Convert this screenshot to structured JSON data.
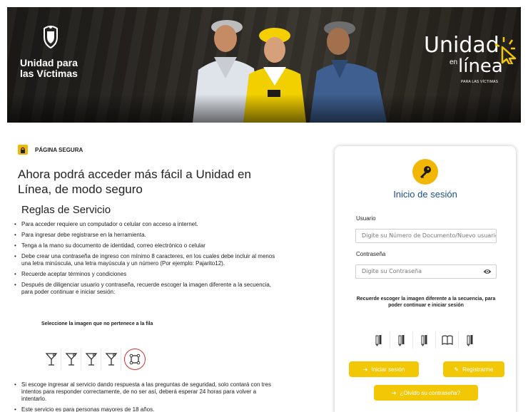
{
  "banner": {
    "org_name_line1": "Unidad para",
    "org_name_line2": "las Víctimas",
    "product_word1": "Unidad",
    "product_en": "en",
    "product_word2": "línea",
    "product_tag": "PARA LAS VÍCTIMAS"
  },
  "secure": {
    "label": "PÁGINA SEGURA",
    "icon": "lock-icon"
  },
  "headline": "Ahora podrá acceder más fácil a Unidad en Línea, de modo seguro",
  "rules_title": "Reglas de Servicio",
  "rules": [
    "Para acceder requiere un computador o celular con acceso a internet.",
    "Para ingresar debe registrarse en la herramienta.",
    "Tenga a la mano su documento de identidad, correo electrónico o celular",
    "Debe crear una contraseña de ingreso con mínimo 8 caracteres, en los cuales debe incluir al menos una letra minúscula, una letra mayúscula y un número (Por ejemplo: Pajarito12).",
    "Recuerde aceptar términos y condiciones",
    "Después de diligenciar usuario y contraseña, recuerde escoger la imagen diferente a la secuencia, para poder continuar e iniciar sesión:"
  ],
  "example": {
    "title": "Seleccione la imagen que no pertenece a la fila"
  },
  "rules_after": [
    "Si escoge ingresar al servicio dando respuesta a las preguntas de seguridad, solo contará con tres intentos para responder correctamente, de no ser así, deberá esperar 24 horas para volver a intentarlo.",
    "Este servicio es para personas mayores de 18 años."
  ],
  "login": {
    "title": "Inicio de sesión",
    "user_label": "Usuario",
    "user_placeholder": "Digite su Número de Documento/Nuevo usuario",
    "pass_label": "Contraseña",
    "pass_placeholder": "Digite su Contraseña",
    "notice": "Recuerde escoger la imagen diferente a la secuencia, para poder continuar e iniciar sesión",
    "login_button": "Iniciar sesión",
    "register_button": "Registrarme",
    "forgot_button": "¿Olvido su contraseña?"
  },
  "colors": {
    "accent": "#f2c705",
    "title_blue": "#1d4e8c",
    "selected_red": "#d32f2f"
  }
}
